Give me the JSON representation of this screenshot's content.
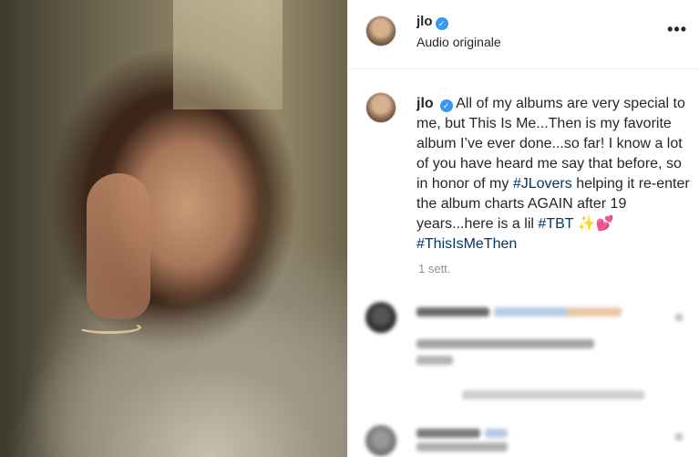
{
  "post": {
    "username": "jlo",
    "verified_glyph": "✓",
    "audio_label": "Audio originale",
    "more_label": "•••"
  },
  "caption": {
    "username": "jlo",
    "text_1": "All of my albums are very special to me, but This Is Me...Then is my favorite album I’ve ever done...so far! I know a lot of you have heard me say that before, so in honor of my ",
    "tag_1": "#JLovers",
    "text_2": " helping it re-enter the album charts AGAIN after 19 years...here is a lil ",
    "tag_2": "#TBT",
    "emoji": " ✨💕 ",
    "tag_3": "#ThisIsMeThen",
    "time": "1 sett."
  },
  "icons": {
    "verified": "verified-badge-icon",
    "more": "more-options-icon"
  },
  "colors": {
    "hashtag": "#00376b",
    "verified": "#3897f0",
    "secondary_text": "#8e8e8e"
  }
}
